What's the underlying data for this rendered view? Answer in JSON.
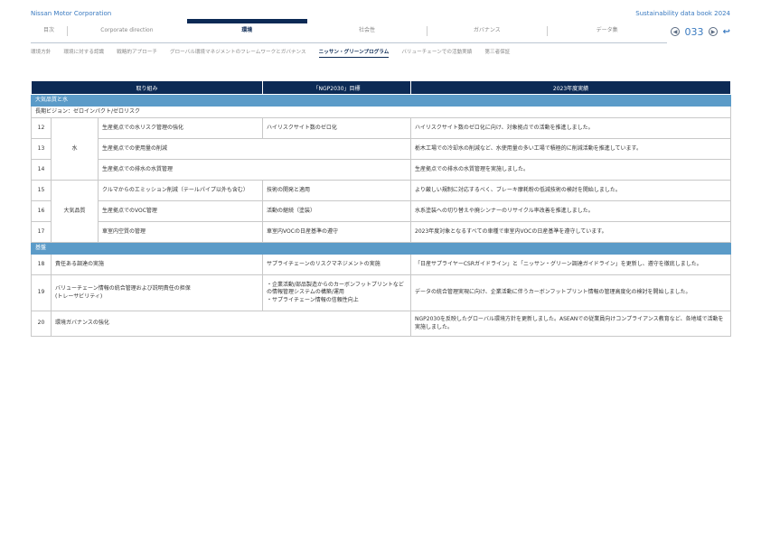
{
  "header": {
    "brand": "Nissan Motor Corporation",
    "report": "Sustainability data book 2024"
  },
  "nav": {
    "tabs": [
      "目次",
      "Corporate direction",
      "環境",
      "社会性",
      "ガバナンス",
      "データ集"
    ],
    "page": "033"
  },
  "subnav": [
    "環境方針",
    "環境に対する認識",
    "戦略的アプローチ",
    "グローバル環境マネジメントのフレームワークとガバナンス",
    "ニッサン・グリーンプログラム",
    "バリューチェーンでの活動実績",
    "第三者保証"
  ],
  "table": {
    "headers": [
      "取り組み",
      "「NGP2030」目標",
      "2023年度実績"
    ],
    "section1": "大気品質と水",
    "vision": "長期ビジョン：ゼロインパクト/ゼロリスク",
    "cat_water": "水",
    "cat_air": "大気品質",
    "section2": "基盤",
    "rows": [
      {
        "no": "12",
        "task": "生産拠点での水リスク管理の強化",
        "goal": "ハイリスクサイト数のゼロ化",
        "result": "ハイリスクサイト数のゼロ化に向け、対象拠点での活動を推進しました。"
      },
      {
        "no": "13",
        "task": "生産拠点での使用量の削減",
        "goal": "",
        "result": "栃木工場での冷却水の削減など、水使用量の多い工場で積極的に削減活動を推進しています。"
      },
      {
        "no": "14",
        "task": "生産拠点での排水の水質管理",
        "goal": "",
        "result": "生産拠点での排水の水質管理を実施しました。"
      },
      {
        "no": "15",
        "task": "クルマからのエミッション削減（テールパイプ以外も含む）",
        "goal": "技術の開発と適用",
        "result": "より厳しい規制に対応するべく、ブレーキ摩耗粉の低減技術の検討を開始しました。"
      },
      {
        "no": "16",
        "task": "生産拠点でのVOC管理",
        "goal": "活動の継続（塗装）",
        "result": "水系塗装への切り替えや廃シンナーのリサイクル率改善を推進しました。"
      },
      {
        "no": "17",
        "task": "車室内空質の管理",
        "goal": "車室内VOCの日産基準の遵守",
        "result": "2023年度対象となるすべての車種で車室内VOCの日産基準を遵守しています。"
      },
      {
        "no": "18",
        "task": "責任ある調達の実施",
        "goal": "サプライチェーンのリスクマネジメントの実施",
        "result": "「日産サプライヤーCSRガイドライン」と「ニッサン・グリーン調達ガイドライン」を更新し、遵守を徹底しました。"
      },
      {
        "no": "19",
        "task": "バリューチェーン情報の統合管理および説明責任の担保\n(トレーサビリティ)",
        "goal": "・企業活動/部品製造からのカーボンフットプリントなどの情報管理システムの構築/運用\n・サプライチェーン情報の信頼性向上",
        "result": "データの統合管理実現に向け、企業活動に伴うカーボンフットプリント情報の管理高度化の検討を開始しました。"
      },
      {
        "no": "20",
        "task": "環境ガバナンスの強化",
        "goal": "",
        "result": "NGP2030を反映したグローバル環境方針を更新しました。ASEANでの従業員向けコンプライアンス教育など、各地域で活動を実施しました。"
      }
    ]
  }
}
